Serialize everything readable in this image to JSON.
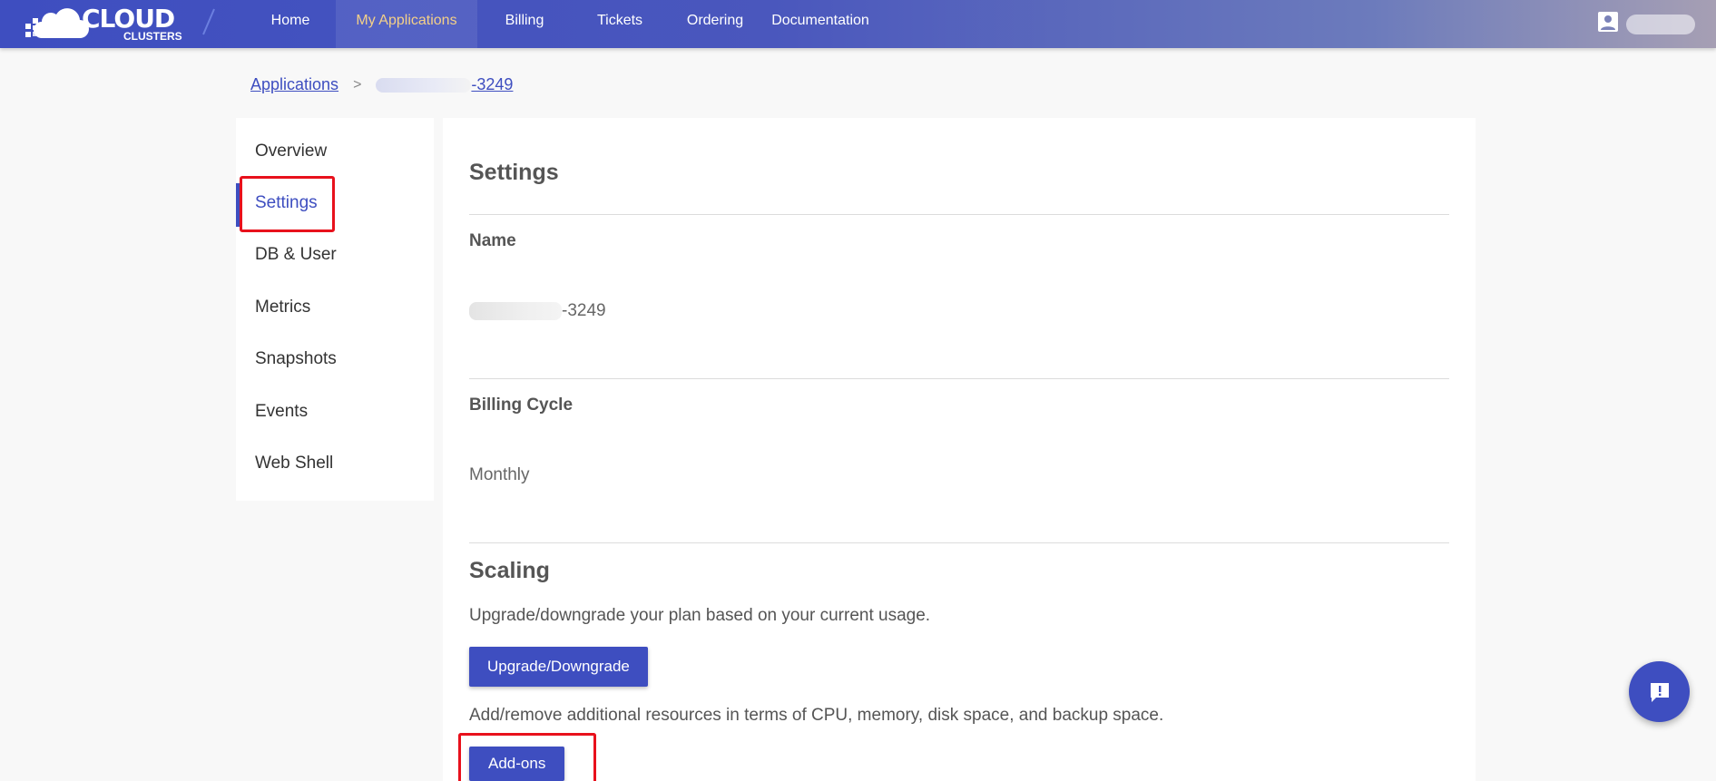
{
  "header": {
    "logo_main": "CLOUD",
    "logo_sub": "CLUSTERS",
    "nav": [
      {
        "label": "Home"
      },
      {
        "label": "My Applications"
      },
      {
        "label": "Billing"
      },
      {
        "label": "Tickets"
      },
      {
        "label": "Ordering"
      },
      {
        "label": "Documentation"
      }
    ],
    "active_nav": "My Applications",
    "user_icon": "user-icon"
  },
  "breadcrumb": {
    "root": "Applications",
    "separator": ">",
    "current_suffix": "-3249"
  },
  "sidebar": {
    "items": [
      {
        "label": "Overview"
      },
      {
        "label": "Settings"
      },
      {
        "label": "DB & User"
      },
      {
        "label": "Metrics"
      },
      {
        "label": "Snapshots"
      },
      {
        "label": "Events"
      },
      {
        "label": "Web Shell"
      }
    ],
    "active": "Settings"
  },
  "settings": {
    "title": "Settings",
    "name_label": "Name",
    "name_suffix": "-3249",
    "billing_label": "Billing Cycle",
    "billing_value": "Monthly"
  },
  "scaling": {
    "title": "Scaling",
    "upgrade_desc": "Upgrade/downgrade your plan based on your current usage.",
    "upgrade_button": "Upgrade/Downgrade",
    "addons_desc": "Add/remove additional resources in terms of CPU, memory, disk space, and backup space.",
    "addons_button": "Add-ons"
  },
  "chat": {
    "icon": "chat-icon"
  },
  "colors": {
    "primary": "#3e4ec0",
    "active_nav_text": "#f4d088",
    "highlight": "#e8111c"
  }
}
